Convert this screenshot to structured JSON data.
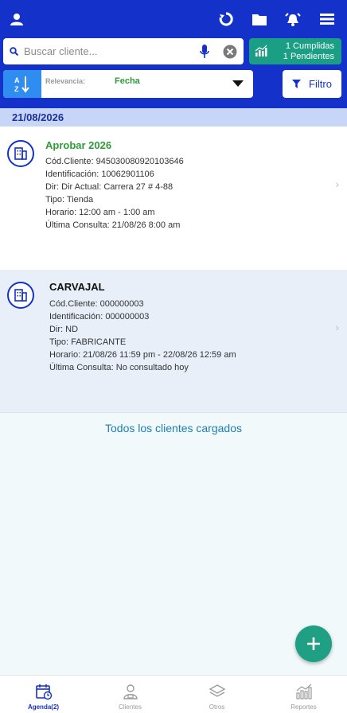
{
  "search": {
    "placeholder": "Buscar cliente..."
  },
  "stats": {
    "cumplidas": "1 Cumplidas",
    "pendientes": "1 Pendientes"
  },
  "sort": {
    "label": "Relevancia:",
    "value": "Fecha"
  },
  "filter": {
    "label": "Filtro"
  },
  "date_header": "21/08/2026",
  "clients": [
    {
      "name": "Aprobar 2026",
      "codigo": "Cód.Cliente: 945030080920103646",
      "identificacion": "Identificación: 10062901106",
      "dir": "Dir: Dir Actual: Carrera 27 # 4-88",
      "tipo": "Tipo: Tienda",
      "horario": "Horario: 12:00 am - 1:00 am",
      "ultima": "Última Consulta: 21/08/26 8:00 am"
    },
    {
      "name": "CARVAJAL",
      "codigo": "Cód.Cliente: 000000003",
      "identificacion": "Identificación: 000000003",
      "dir": "Dir: ND",
      "tipo": "Tipo: FABRICANTE",
      "horario": "Horario: 21/08/26 11:59 pm - 22/08/26 12:59 am",
      "ultima": "Última Consulta: No consultado hoy"
    }
  ],
  "footer_message": "Todos los clientes cargados",
  "bottom_nav": [
    {
      "label": "Agenda(2)",
      "icon": "calendar-icon",
      "active": true
    },
    {
      "label": "Clientes",
      "icon": "user-icon"
    },
    {
      "label": "Otros",
      "icon": "layers-icon"
    },
    {
      "label": "Reportes",
      "icon": "bar-chart-icon"
    }
  ],
  "colors": {
    "primary": "#1431c9",
    "accent_green": "#1b9f84",
    "date_green": "#2e9b3a"
  }
}
